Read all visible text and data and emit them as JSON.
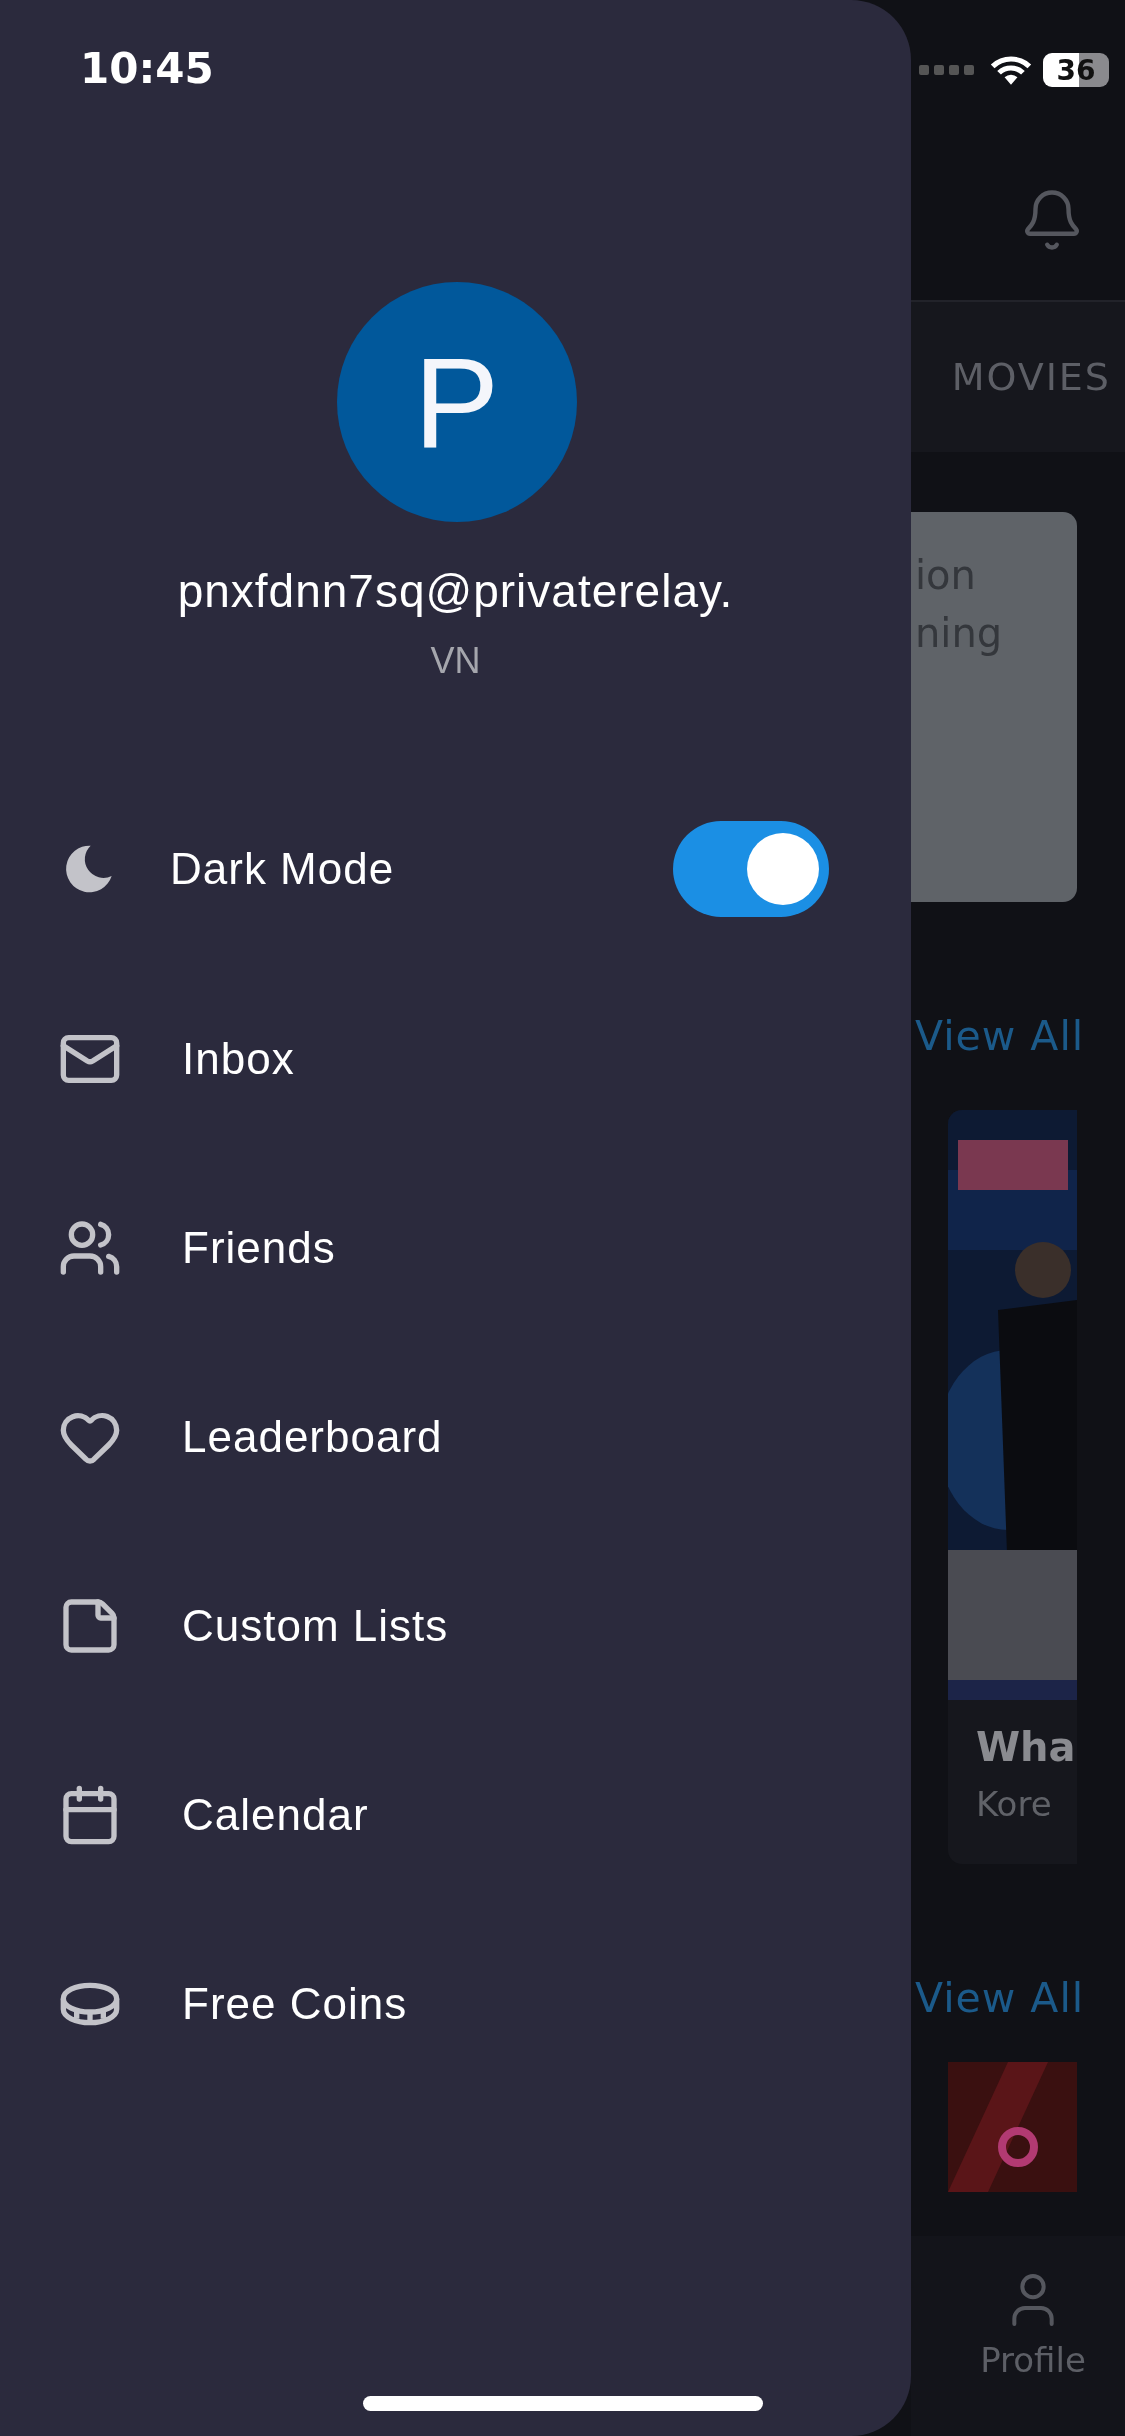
{
  "status_bar": {
    "time": "10:45",
    "battery": "36"
  },
  "drawer": {
    "avatar_letter": "P",
    "email": "pnxfdnn7sq@privaterelay.",
    "region": "VN",
    "dark_mode": {
      "label": "Dark Mode",
      "on": true
    },
    "menu": [
      {
        "kind": "inbox",
        "label": "Inbox"
      },
      {
        "kind": "friends",
        "label": "Friends"
      },
      {
        "kind": "leaderboard",
        "label": "Leaderboard"
      },
      {
        "kind": "lists",
        "label": "Custom Lists"
      },
      {
        "kind": "calendar",
        "label": "Calendar"
      },
      {
        "kind": "coins",
        "label": "Free Coins"
      }
    ]
  },
  "background": {
    "tab": "MOVIES",
    "banner_lines": [
      "ion",
      "ning"
    ],
    "sections": [
      {
        "link": "View All",
        "card": {
          "title": "Wha",
          "subtitle": "Kore"
        }
      },
      {
        "link": "View All"
      }
    ],
    "nav": {
      "label": "Profile"
    }
  }
}
